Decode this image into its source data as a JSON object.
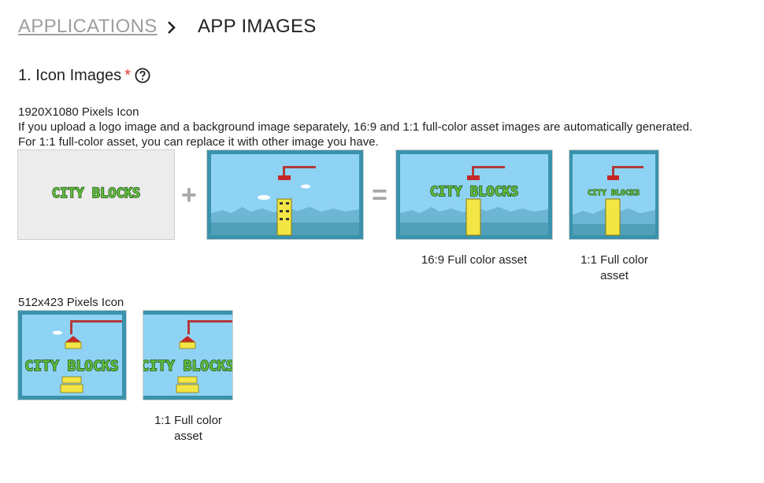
{
  "breadcrumb": {
    "parent_label": "APPLICATIONS",
    "current_label": "APP IMAGES",
    "separator_icon": "chevron-right-icon"
  },
  "section": {
    "title": "1. Icon Images",
    "required_mark": "*",
    "help_icon": "question-circle-icon"
  },
  "icon_1920": {
    "heading": "1920X1080 Pixels Icon",
    "description_line1": "If you upload a logo image and a background image separately, 16:9 and 1:1 full-color asset images are automatically generated.",
    "description_line2": "For 1:1 full-color asset, you can replace it with other image you have.",
    "logo_text": "CITY BLOCKS",
    "plus_symbol": "+",
    "equals_symbol": "=",
    "caption_16_9": "16:9 Full color asset",
    "caption_1_1_line1": "1:1 Full color",
    "caption_1_1_line2": "asset"
  },
  "icon_512": {
    "heading": "512x423 Pixels Icon",
    "logo_text": "CITY BLOCKS",
    "caption_1_1_line1": "1:1 Full color",
    "caption_1_1_line2": "asset"
  },
  "colors": {
    "sky": "#8fd3f4",
    "frame": "#3a93ad",
    "logo_green": "#5fbf3a",
    "logo_outline": "#1f4d12",
    "block_yellow": "#f3e544",
    "roof_red": "#c62828",
    "crane_red": "#b23a3a"
  }
}
